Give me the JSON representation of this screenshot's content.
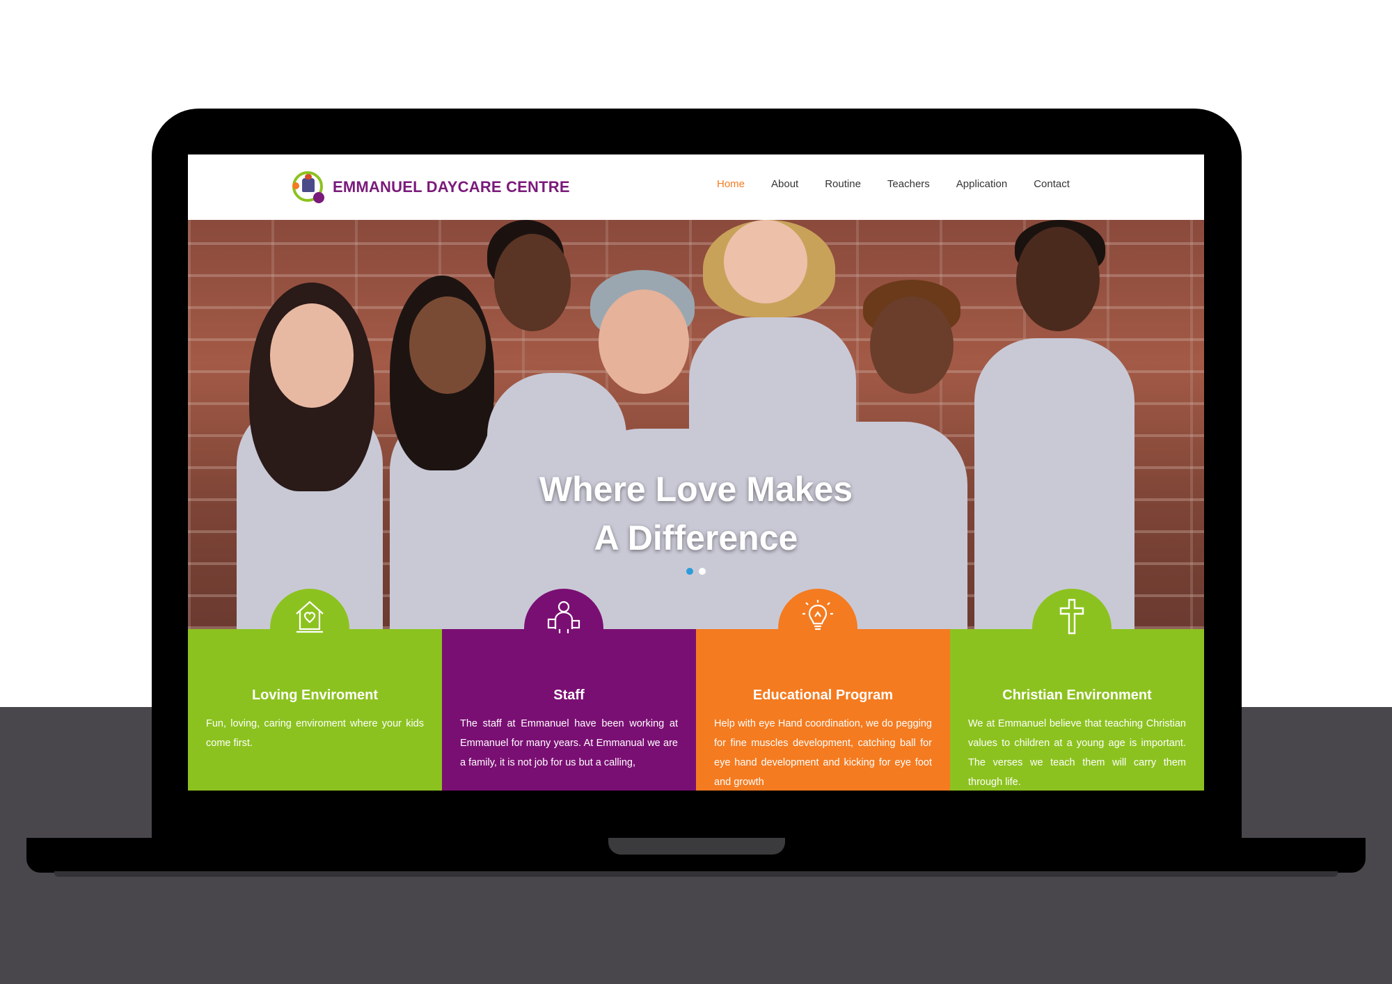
{
  "site": {
    "logo_text": "EMMANUEL DAYCARE CENTRE"
  },
  "nav": {
    "items": [
      {
        "label": "Home",
        "active": true
      },
      {
        "label": "About",
        "active": false
      },
      {
        "label": "Routine",
        "active": false
      },
      {
        "label": "Teachers",
        "active": false
      },
      {
        "label": "Application",
        "active": false
      },
      {
        "label": "Contact",
        "active": false
      }
    ]
  },
  "hero": {
    "title_line1": "Where Love Makes",
    "title_line2": "A Difference",
    "slides": 2,
    "active_slide": 1
  },
  "features": [
    {
      "title": "Loving Enviroment",
      "text": "Fun, loving, caring enviroment where your kids come first.",
      "color": "#8cc21f",
      "icon": "house-heart-icon"
    },
    {
      "title": "Staff",
      "text": "The staff at Emmanuel have been working at Emmanuel for many years. At Emmanual we are a family, it is not job for us but a calling,",
      "color": "#7a0f73",
      "icon": "teacher-icon"
    },
    {
      "title": "Educational Program",
      "text": "Help with eye Hand coordination, we do pegging for fine muscles development, catching ball for eye hand development and kicking for eye foot and growth",
      "color": "#f47b20",
      "icon": "lightbulb-icon"
    },
    {
      "title": "Christian Environment",
      "text": "We at Emmanuel believe that teaching Christian values to children at a young age is important. The verses we teach them will carry them through life.",
      "color": "#8cc21f",
      "icon": "cross-icon"
    }
  ],
  "colors": {
    "accent_orange": "#f47b20",
    "brand_purple": "#7a1a7a",
    "brand_green": "#8cc21f",
    "slider_dot_active": "#2d9cdb"
  }
}
